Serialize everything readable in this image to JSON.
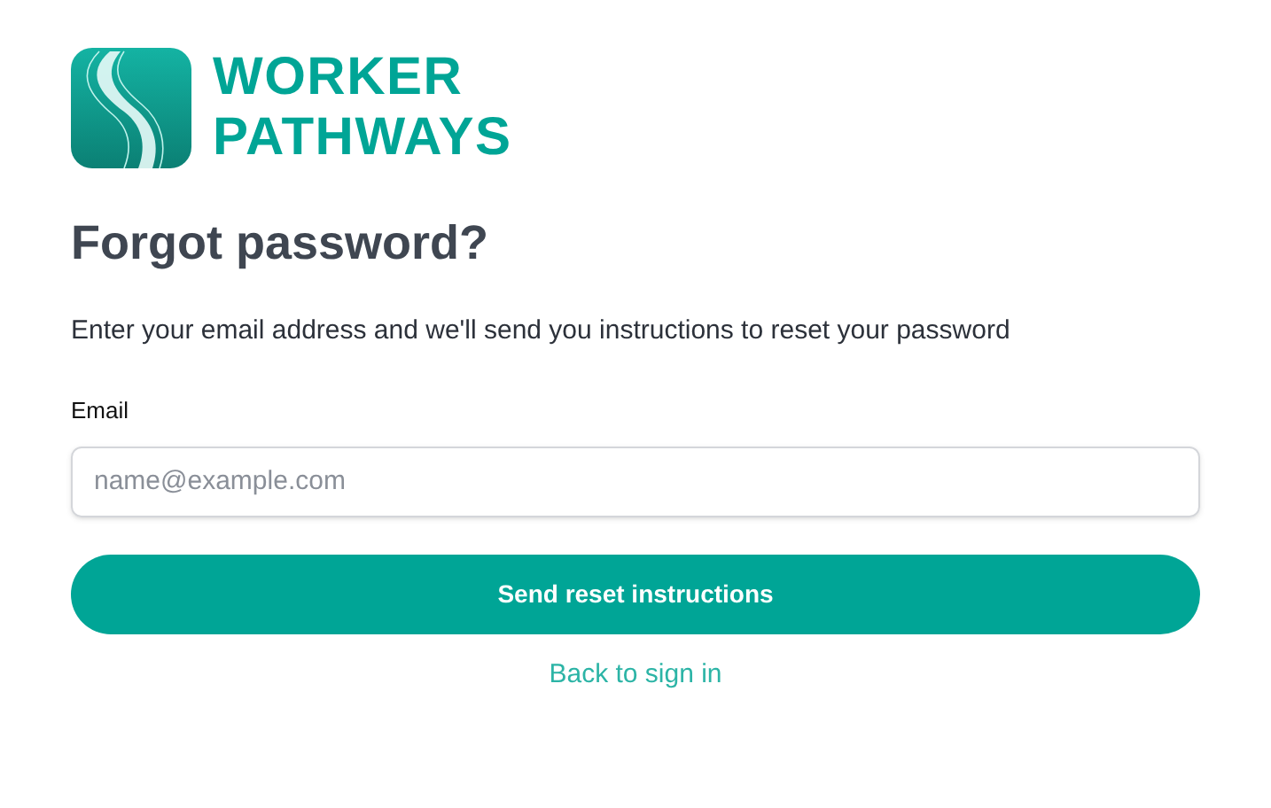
{
  "logo": {
    "line_1": "WORKER",
    "line_2": "PATHWAYS"
  },
  "heading": "Forgot password?",
  "description": "Enter your email address and we'll send you instructions to reset your password",
  "email": {
    "label": "Email",
    "placeholder": "name@example.com"
  },
  "submit": "Send reset instructions",
  "back_link": "Back to sign in"
}
